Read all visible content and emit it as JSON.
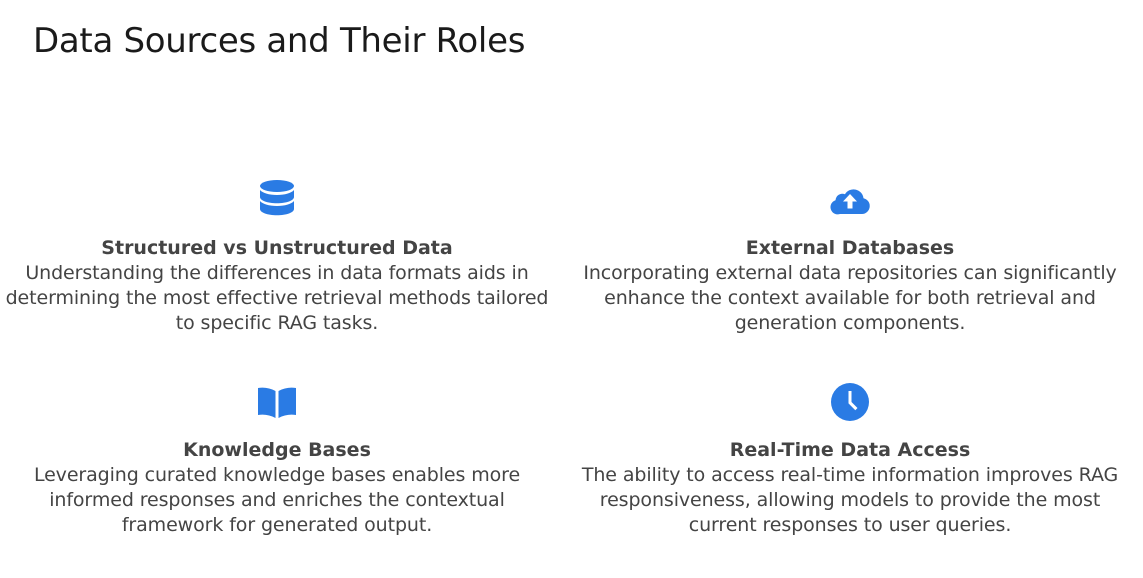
{
  "page": {
    "title": "Data Sources and Their Roles",
    "accent_color": "#2a7be4"
  },
  "cards": [
    {
      "icon": "database-icon",
      "heading": "Structured vs Unstructured Data",
      "body": "Understanding the differences in data formats aids in determining the most effective retrieval methods tailored to specific RAG tasks."
    },
    {
      "icon": "cloud-upload-icon",
      "heading": "External Databases",
      "body": "Incorporating external data repositories can significantly enhance the context available for both retrieval and generation components."
    },
    {
      "icon": "book-open-icon",
      "heading": "Knowledge Bases",
      "body": "Leveraging curated knowledge bases enables more informed responses and enriches the contextual framework for generated output."
    },
    {
      "icon": "clock-icon",
      "heading": "Real-Time Data Access",
      "body": "The ability to access real-time information improves RAG responsiveness, allowing models to provide the most current responses to user queries."
    }
  ]
}
